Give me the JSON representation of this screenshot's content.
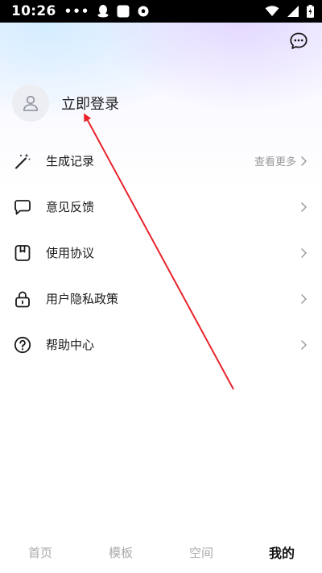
{
  "status_bar": {
    "time": "10:26",
    "dots": "•••",
    "icons": [
      "qq-penguin-icon",
      "square-app-icon",
      "soccer-ball-icon",
      "wifi-icon",
      "signal-icon",
      "battery-icon"
    ]
  },
  "header": {
    "chat_icon": "chat-bubble-icon"
  },
  "profile": {
    "login_label": "立即登录",
    "avatar_icon": "user-icon"
  },
  "menu": {
    "items": [
      {
        "label": "生成记录",
        "extra": "查看更多",
        "icon": "magic-wand-icon"
      },
      {
        "label": "意见反馈",
        "extra": "",
        "icon": "feedback-bubble-icon"
      },
      {
        "label": "使用协议",
        "extra": "",
        "icon": "document-icon"
      },
      {
        "label": "用户隐私政策",
        "extra": "",
        "icon": "lock-icon"
      },
      {
        "label": "帮助中心",
        "extra": "",
        "icon": "help-circle-icon"
      }
    ]
  },
  "tabbar": {
    "tabs": [
      {
        "label": "首页",
        "active": false
      },
      {
        "label": "模板",
        "active": false
      },
      {
        "label": "空间",
        "active": false
      },
      {
        "label": "我的",
        "active": true
      }
    ]
  },
  "colors": {
    "annotation_arrow": "#e8232a",
    "inactive_tab": "#aaaaaa",
    "active_tab": "#111111"
  }
}
